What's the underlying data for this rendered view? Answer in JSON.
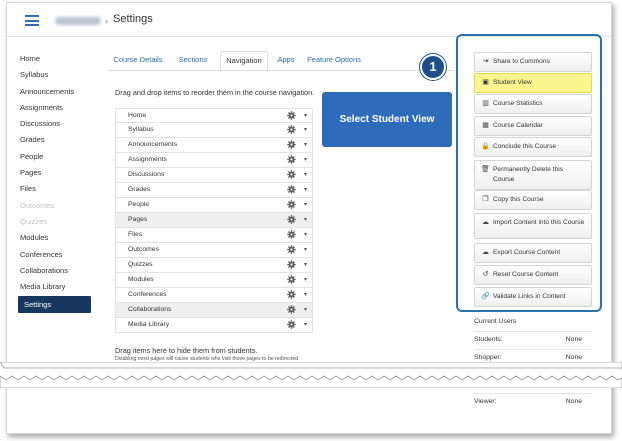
{
  "header": {
    "title": "Settings",
    "separator": "›"
  },
  "sidebar": {
    "items": [
      {
        "label": "Home",
        "state": "normal"
      },
      {
        "label": "Syllabus",
        "state": "normal"
      },
      {
        "label": "Announcements",
        "state": "normal"
      },
      {
        "label": "Assignments",
        "state": "normal"
      },
      {
        "label": "Discussions",
        "state": "normal"
      },
      {
        "label": "Grades",
        "state": "normal"
      },
      {
        "label": "People",
        "state": "normal"
      },
      {
        "label": "Pages",
        "state": "normal"
      },
      {
        "label": "Files",
        "state": "normal"
      },
      {
        "label": "Outcomes",
        "state": "disabled"
      },
      {
        "label": "Quizzes",
        "state": "disabled"
      },
      {
        "label": "Modules",
        "state": "normal"
      },
      {
        "label": "Conferences",
        "state": "normal"
      },
      {
        "label": "Collaborations",
        "state": "normal"
      },
      {
        "label": "Media Library",
        "state": "normal"
      },
      {
        "label": "Settings",
        "state": "active"
      }
    ]
  },
  "tabs": [
    {
      "label": "Course Details",
      "active": false
    },
    {
      "label": "Sections",
      "active": false
    },
    {
      "label": "Navigation",
      "active": true
    },
    {
      "label": "Apps",
      "active": false
    },
    {
      "label": "Feature Options",
      "active": false
    }
  ],
  "navigation": {
    "instruction": "Drag and drop items to reorder them in the course navigation.",
    "items": [
      {
        "label": "Home",
        "shaded": false
      },
      {
        "label": "Syllabus",
        "shaded": false
      },
      {
        "label": "Announcements",
        "shaded": false
      },
      {
        "label": "Assignments",
        "shaded": false
      },
      {
        "label": "Discussions",
        "shaded": false
      },
      {
        "label": "Grades",
        "shaded": false
      },
      {
        "label": "People",
        "shaded": false
      },
      {
        "label": "Pages",
        "shaded": true
      },
      {
        "label": "Files",
        "shaded": false
      },
      {
        "label": "Outcomes",
        "shaded": false
      },
      {
        "label": "Quizzes",
        "shaded": false
      },
      {
        "label": "Modules",
        "shaded": false
      },
      {
        "label": "Conferences",
        "shaded": false
      },
      {
        "label": "Collaborations",
        "shaded": true
      },
      {
        "label": "Media Library",
        "shaded": false
      }
    ],
    "hide_heading": "Drag items here to hide them from students.",
    "hide_note": "Disabling most pages will cause students who visit those pages to be redirected"
  },
  "callout": {
    "text": "Select Student View",
    "badge": "1"
  },
  "actions": [
    {
      "label": "Share to Commons",
      "icon": "share-icon",
      "glyph": "⇥",
      "highlight": false
    },
    {
      "label": "Student View",
      "icon": "student-view-icon",
      "glyph": "▣",
      "highlight": true
    },
    {
      "label": "Course Statistics",
      "icon": "statistics-icon",
      "glyph": "▥",
      "highlight": false
    },
    {
      "label": "Course Calendar",
      "icon": "calendar-icon",
      "glyph": "▦",
      "highlight": false
    },
    {
      "label": "Conclude this Course",
      "icon": "lock-icon",
      "glyph": "🔒",
      "highlight": false
    },
    {
      "label": "Permanently Delete this Course",
      "icon": "trash-icon",
      "glyph": "🗑",
      "highlight": false
    },
    {
      "label": "Copy this Course",
      "icon": "copy-icon",
      "glyph": "❐",
      "highlight": false
    },
    {
      "label": "Import Content into this Course",
      "icon": "cloud-upload-icon",
      "glyph": "☁",
      "highlight": false
    },
    {
      "label": "Export Course Content",
      "icon": "cloud-download-icon",
      "glyph": "☁",
      "highlight": false
    },
    {
      "label": "Reset Course Content",
      "icon": "reset-icon",
      "glyph": "↺",
      "highlight": false
    },
    {
      "label": "Validate Links in Content",
      "icon": "link-icon",
      "glyph": "🔗",
      "highlight": false
    }
  ],
  "users": {
    "heading": "Current Users",
    "rows": [
      {
        "label": "Students:",
        "value": "None"
      },
      {
        "label": "Shopper:",
        "value": "None"
      },
      {
        "label": "Viewer:",
        "value": "None"
      }
    ]
  },
  "colors": {
    "accent": "#2d6fb3",
    "sidebar_active": "#16375e",
    "callout": "#2e6cb9",
    "highlight": "#fdf58d"
  }
}
